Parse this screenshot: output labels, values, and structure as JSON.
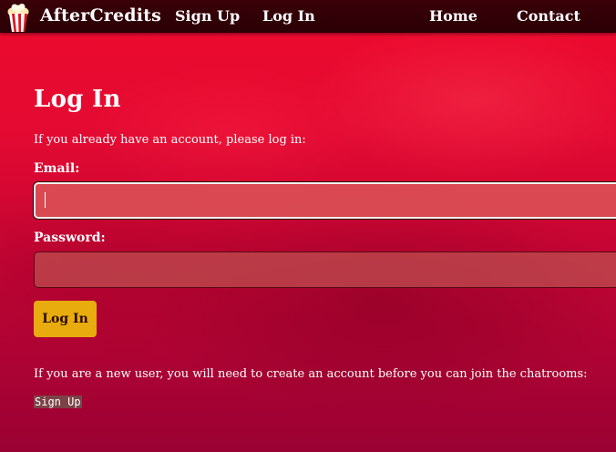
{
  "navbar": {
    "brand": "AfterCredits",
    "links": [
      {
        "label": "Sign Up"
      },
      {
        "label": "Log In"
      },
      {
        "label": "Home"
      },
      {
        "label": "Contact"
      }
    ]
  },
  "main": {
    "title": "Log In",
    "intro": "If you already have an account, please log in:",
    "email_label": "Email:",
    "email_value": "",
    "password_label": "Password:",
    "password_value": "",
    "login_button": "Log In",
    "new_user_text": "If you are a new user, you will need to create an account before you can join the chatrooms:",
    "signup_link": "Sign Up"
  },
  "colors": {
    "navbar_bg": "#2a0006",
    "page_bg_top": "#ee0a2d",
    "page_bg_bottom": "#9a0233",
    "button_bg": "#e8ac0e"
  },
  "icons": {
    "logo": "popcorn-icon"
  }
}
